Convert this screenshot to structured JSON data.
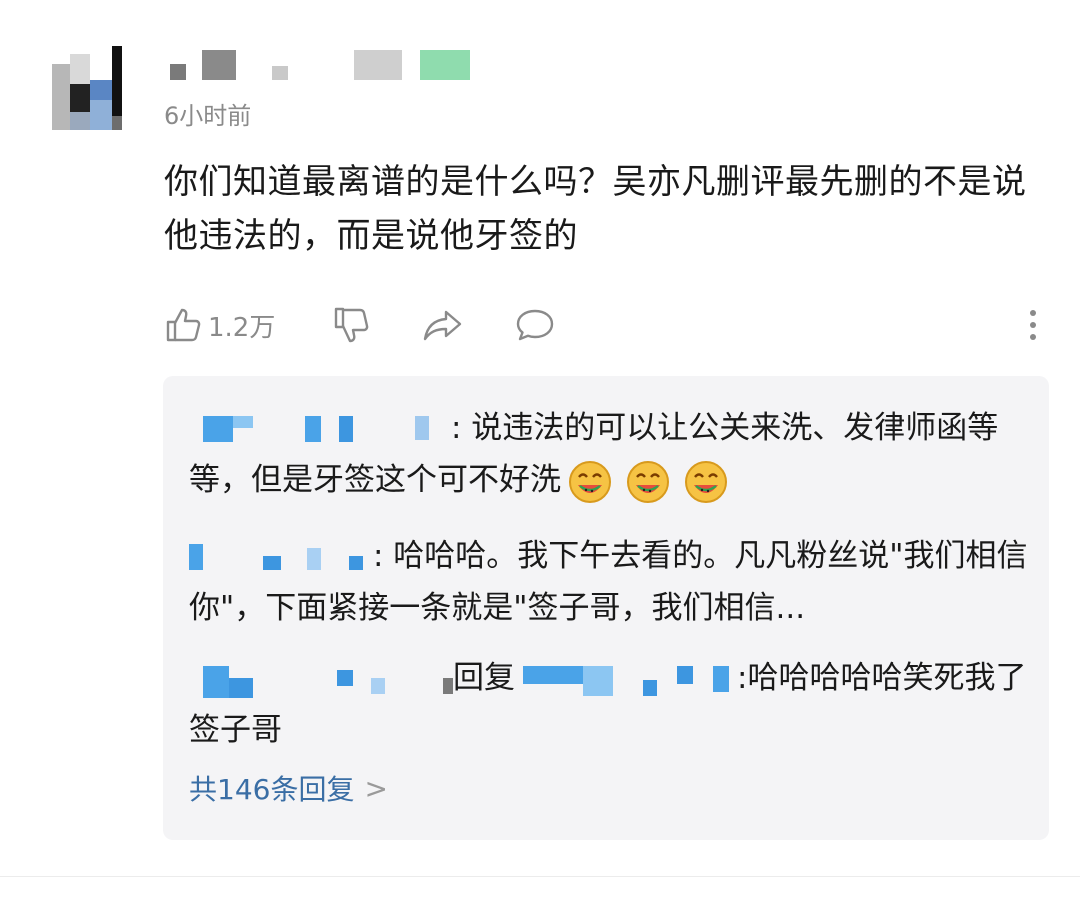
{
  "comment": {
    "time": "6小时前",
    "text": "你们知道最离谱的是什么吗？吴亦凡删评最先删的不是说他违法的，而是说他牙签的",
    "like_count": "1.2万"
  },
  "icons": {
    "like": "thumbs-up-icon",
    "dislike": "thumbs-down-icon",
    "share": "share-icon",
    "comment": "comment-bubble-icon",
    "more": "more-vertical-icon",
    "emoji": "watermelon-grin-emoji"
  },
  "replies": [
    {
      "text": ": 说违法的可以让公关来洗、发律师函等等，但是牙签这个可不好洗",
      "emoji_count": 3
    },
    {
      "text": ": 哈哈哈。我下午去看的。凡凡粉丝说\"我们相信你\"，下面紧接一条就是\"签子哥，我们相信..."
    },
    {
      "reply_word": "回复",
      "text": ":哈哈哈哈哈笑死我了签子哥"
    }
  ],
  "more_replies": {
    "label": "共146条回复",
    "chevron": ">"
  },
  "colors": {
    "link": "#3a6ea5",
    "reply_bg": "#f4f4f6",
    "muted": "#8a8a8a",
    "blur_blue": "#4aa3e8",
    "blur_green": "#7fd6a0"
  }
}
